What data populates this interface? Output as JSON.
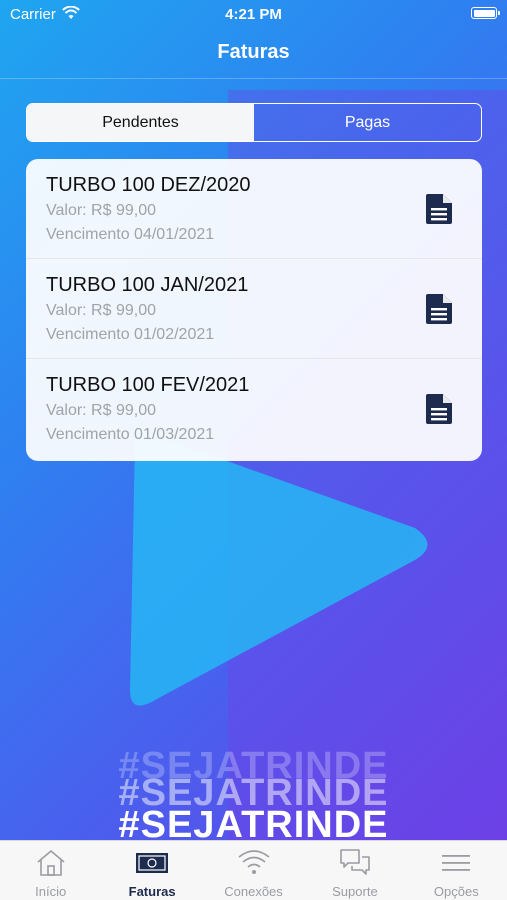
{
  "status_bar": {
    "carrier": "Carrier",
    "time": "4:21 PM"
  },
  "header": {
    "title": "Faturas"
  },
  "segments": {
    "pending": "Pendentes",
    "paid": "Pagas",
    "selected": "Pendentes"
  },
  "invoices": [
    {
      "title": "TURBO 100 DEZ/2020",
      "valor": "Valor: R$ 99,00",
      "vencimento": "Vencimento 04/01/2021"
    },
    {
      "title": "TURBO 100 JAN/2021",
      "valor": "Valor: R$ 99,00",
      "vencimento": "Vencimento 01/02/2021"
    },
    {
      "title": "TURBO 100 FEV/2021",
      "valor": "Valor: R$ 99,00",
      "vencimento": "Vencimento 01/03/2021"
    }
  ],
  "slogan": "#SEJATRINDE",
  "tabbar": {
    "items": [
      {
        "label": "Início",
        "icon": "home-icon"
      },
      {
        "label": "Faturas",
        "icon": "invoice-icon"
      },
      {
        "label": "Conexões",
        "icon": "wifi-icon"
      },
      {
        "label": "Suporte",
        "icon": "chat-bubbles-icon"
      },
      {
        "label": "Opções",
        "icon": "menu-icon"
      }
    ],
    "active": "Faturas"
  },
  "colors": {
    "primary_dark": "#1d2b4f",
    "inactive_tab": "#9a9ca2",
    "bg_start": "#1fa6f0",
    "bg_end": "#6a3fe6"
  }
}
